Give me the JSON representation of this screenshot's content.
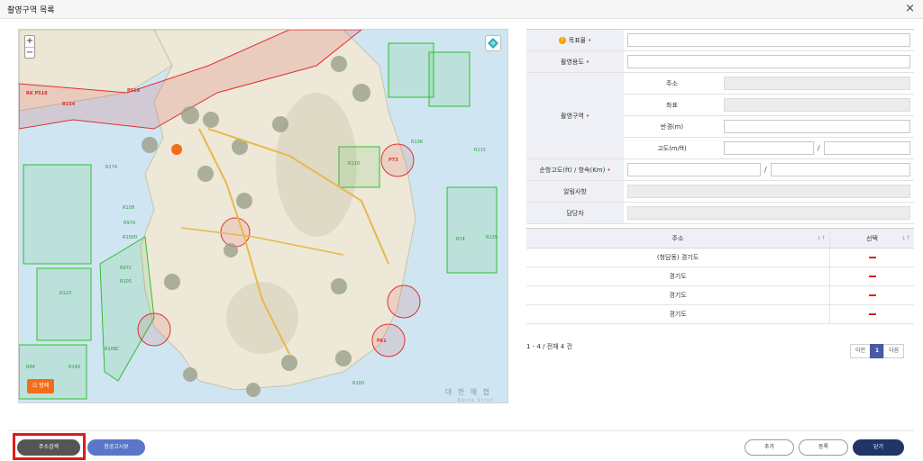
{
  "window": {
    "title": "촬영구역 목록",
    "close_icon": "×"
  },
  "map": {
    "zoom_in": "+",
    "zoom_out": "−",
    "legend_button": "☷ 범례",
    "sea_label": "대 한 해 협",
    "sea_sublabel": "Korea Strait",
    "zone_labels": [
      "RK P518",
      "R154",
      "P518",
      "R174",
      "R108",
      "R105",
      "R97C",
      "R123",
      "R84",
      "R140",
      "R110",
      "R74",
      "R136",
      "R139",
      "R115",
      "P73",
      "P61",
      "R97A",
      "R1000",
      "R108C",
      "R100"
    ]
  },
  "form": {
    "target_label": "목표물",
    "purpose_label": "촬영용도",
    "area_label": "촬영구역",
    "address_label": "주소",
    "coord_label": "좌표",
    "radius_label": "반경(m)",
    "altitude_label": "고도(m/ft)",
    "cruise_label": "순항고도(ft) / 항속(Km)",
    "notice_label": "알림사항",
    "manager_label": "담당자",
    "required_mark": "•",
    "warn_icon": "!",
    "slash": "/"
  },
  "grid": {
    "col_address": "주소",
    "col_select": "선택",
    "sort_icon": "↓↑",
    "rows": [
      {
        "address": "(청담동) 경기도"
      },
      {
        "address": "경기도"
      },
      {
        "address": "경기도"
      },
      {
        "address": "경기도"
      }
    ]
  },
  "pagination": {
    "total_text": "1 - 4 / 전체 4 건",
    "prev": "이전",
    "current": "1",
    "next": "다음"
  },
  "footer": {
    "address_search": "주소검색",
    "notice_report": "항공고시보",
    "add": "추가",
    "register": "등록",
    "close": "닫기"
  },
  "colors": {
    "accent": "#1f3566",
    "notice_button": "#5a76c8",
    "legend_button": "#f26d1a",
    "zone_red": "#e03030",
    "zone_green": "#2fbf2f",
    "page_current": "#4a5aa8"
  }
}
